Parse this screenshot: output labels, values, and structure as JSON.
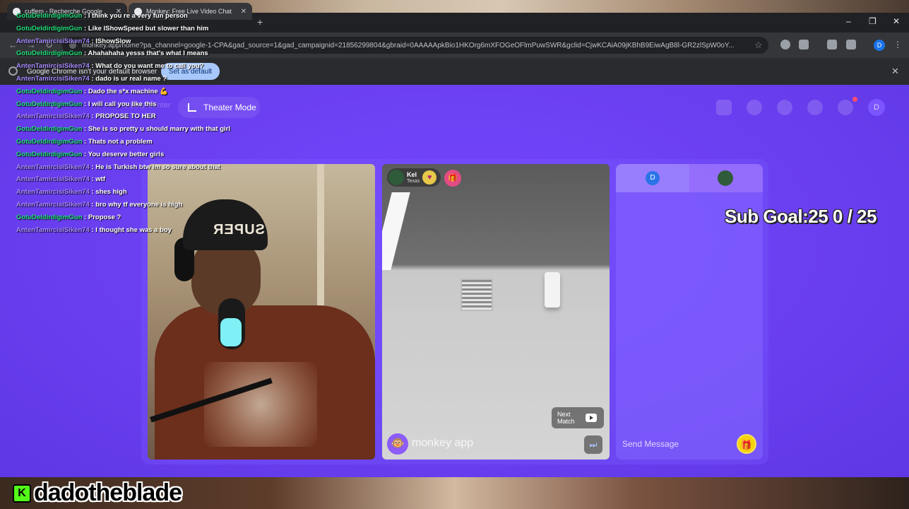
{
  "browser": {
    "tabs": [
      {
        "label": "cuffem - Recherche Google"
      },
      {
        "label": "Monkey: Free Live Video Chat"
      }
    ],
    "new_tab": "+",
    "url": "monkey.app/home?pa_channel=google-1-CPA&gad_source=1&gad_campaignid=21856299804&gbraid=0AAAAApkBio1HKOrg6mXFOGeOFlmPuwSWR&gclid=CjwKCAiA09jKBhB9EiwAgB8l-GR2zlSpW0oY...",
    "profile_initial": "D",
    "window_controls": {
      "minimize": "–",
      "restore": "❐",
      "close": "✕"
    }
  },
  "infobar": {
    "message": "Google Chrome isn't your default browser",
    "button_label": "Set as default",
    "close": "✕"
  },
  "header": {
    "left_faded_items": [
      "Ask App",
      "Safety Center"
    ],
    "theater_mode_label": "Theater Mode",
    "avatar_initial": "D"
  },
  "video": {
    "partner_name": "Kel",
    "partner_location": "Texas",
    "heart": "♥",
    "gift": "🎁",
    "next_match_label": "Next Match",
    "skip_icon": "⏭",
    "brand_logo": "🐵",
    "brand_label": "monkey app",
    "hat_text": "SUPER"
  },
  "chat_panel": {
    "tab_me_initial": "D",
    "send_placeholder": "Send Message",
    "gift_icon": "🎁"
  },
  "overlay": {
    "sub_goal": "Sub Goal:25  0 / 25",
    "streamer_name": "dadotheblade",
    "kick_logo": "K"
  },
  "stream_chat": [
    {
      "user": "GotuDeldirdigimGun",
      "color": "green",
      "message": "I think you re a very fun person"
    },
    {
      "user": "GotuDeldirdigimGun",
      "color": "green",
      "message": "Like IShowSpeed but slower than him"
    },
    {
      "user": "AntenTamircisiSiken74",
      "color": "purple",
      "message": "IShowSlow"
    },
    {
      "user": "GotuDeldirdigimGun",
      "color": "green",
      "message": "Ahahahaha yesss that's what I means"
    },
    {
      "user": "AntenTamircisiSiken74",
      "color": "purple",
      "message": "What do you want me to call you?"
    },
    {
      "user": "AntenTamircisiSiken74",
      "color": "purple",
      "message": "dado is ur real name ?"
    },
    {
      "user": "GotuDeldirdigimGun",
      "color": "green",
      "message": "Dado the s*x machine 💪"
    },
    {
      "user": "GotuDeldirdigimGun",
      "color": "green",
      "message": "I will call you like this"
    },
    {
      "user": "AntenTamircisiSiken74",
      "color": "purple",
      "message": "PROPOSE TO HER"
    },
    {
      "user": "GotuDeldirdigimGun",
      "color": "green",
      "message": "She is so pretty u should marry with that girl"
    },
    {
      "user": "GotuDeldirdigimGun",
      "color": "green",
      "message": "Thats not a problem"
    },
    {
      "user": "GotuDeldirdigimGun",
      "color": "green",
      "message": "You deserve better girls"
    },
    {
      "user": "AntenTamircisiSiken74",
      "color": "purple",
      "message": "He is Turkish btw im so sure about that"
    },
    {
      "user": "AntenTamircisiSiken74",
      "color": "purple",
      "message": "wtf"
    },
    {
      "user": "AntenTamircisiSiken74",
      "color": "purple",
      "message": "shes high"
    },
    {
      "user": "AntenTamircisiSiken74",
      "color": "purple",
      "message": "bro why tf everyone is high"
    },
    {
      "user": "GotuDeldirdigimGun",
      "color": "green",
      "message": "Propose ?"
    },
    {
      "user": "AntenTamircisiSiken74",
      "color": "purple",
      "message": "I thought she was a boy"
    }
  ]
}
